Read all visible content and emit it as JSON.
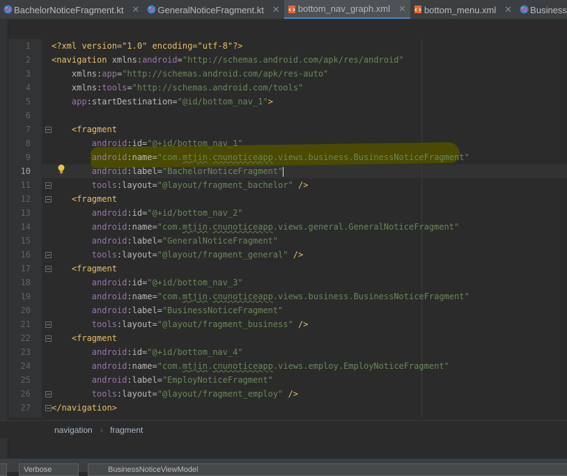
{
  "tabs": [
    {
      "label": "BachelorNoticeFragment.kt",
      "icon": "kotlin-file-icon",
      "active": false
    },
    {
      "label": "GeneralNoticeFragment.kt",
      "icon": "kotlin-file-icon",
      "active": false
    },
    {
      "label": "bottom_nav_graph.xml",
      "icon": "xml-file-icon",
      "active": true
    },
    {
      "label": "bottom_menu.xml",
      "icon": "xml-file-icon",
      "active": false
    },
    {
      "label": "BusinessNoti",
      "icon": "kotlin-file-icon",
      "active": false
    }
  ],
  "close_glyph": "✕",
  "editor": {
    "line_numbers": [
      "1",
      "2",
      "3",
      "4",
      "5",
      "6",
      "7",
      "8",
      "9",
      "10",
      "11",
      "12",
      "13",
      "14",
      "15",
      "16",
      "17",
      "18",
      "19",
      "20",
      "21",
      "22",
      "23",
      "24",
      "25",
      "26",
      "27"
    ],
    "current_line": "10",
    "lines": [
      {
        "indent": "",
        "parts": [
          [
            "pi",
            "<?xml version=\"1.0\" encoding=\"utf-8\"?>"
          ]
        ]
      },
      {
        "indent": "",
        "parts": [
          [
            "t",
            "<navigation "
          ],
          [
            "a",
            "xmlns:"
          ],
          [
            "ns",
            "android"
          ],
          [
            "a",
            "="
          ],
          [
            "v",
            "\"http://schemas.android.com/apk/res/android\""
          ]
        ]
      },
      {
        "indent": "    ",
        "parts": [
          [
            "a",
            "xmlns:"
          ],
          [
            "ns",
            "app"
          ],
          [
            "a",
            "="
          ],
          [
            "v",
            "\"http://schemas.android.com/apk/res-auto\""
          ]
        ]
      },
      {
        "indent": "    ",
        "parts": [
          [
            "a",
            "xmlns:"
          ],
          [
            "ns",
            "tools"
          ],
          [
            "a",
            "="
          ],
          [
            "v",
            "\"http://schemas.android.com/tools\""
          ]
        ]
      },
      {
        "indent": "    ",
        "parts": [
          [
            "ns",
            "app"
          ],
          [
            "a",
            ":startDestination="
          ],
          [
            "v",
            "\"@id/bottom_nav_1\""
          ],
          [
            "t",
            ">"
          ]
        ]
      },
      {
        "indent": "",
        "parts": []
      },
      {
        "indent": "    ",
        "parts": [
          [
            "t",
            "<fragment"
          ]
        ]
      },
      {
        "indent": "        ",
        "parts": [
          [
            "ns",
            "android"
          ],
          [
            "a",
            ":id="
          ],
          [
            "v",
            "\"@+id/bottom_nav_1\""
          ]
        ]
      },
      {
        "indent": "        ",
        "parts": [
          [
            "ns",
            "android"
          ],
          [
            "a",
            ":name="
          ],
          [
            "v",
            "\"com."
          ],
          [
            "vu",
            "mtjin"
          ],
          [
            "v",
            "."
          ],
          [
            "vu",
            "cnunoticeapp"
          ],
          [
            "v",
            ".views.business.BusinessNoticeFragment\""
          ]
        ]
      },
      {
        "indent": "        ",
        "parts": [
          [
            "ns",
            "android"
          ],
          [
            "a",
            ":label="
          ],
          [
            "v",
            "\"BachelorNoticeFragment\""
          ]
        ]
      },
      {
        "indent": "        ",
        "parts": [
          [
            "ns",
            "tools"
          ],
          [
            "a",
            ":layout="
          ],
          [
            "v",
            "\"@layout/fragment_bachelor\""
          ],
          [
            "t",
            " />"
          ]
        ]
      },
      {
        "indent": "    ",
        "parts": [
          [
            "t",
            "<fragment"
          ]
        ]
      },
      {
        "indent": "        ",
        "parts": [
          [
            "ns",
            "android"
          ],
          [
            "a",
            ":id="
          ],
          [
            "v",
            "\"@+id/bottom_nav_2\""
          ]
        ]
      },
      {
        "indent": "        ",
        "parts": [
          [
            "ns",
            "android"
          ],
          [
            "a",
            ":name="
          ],
          [
            "v",
            "\"com."
          ],
          [
            "vu",
            "mtjin"
          ],
          [
            "v",
            "."
          ],
          [
            "vu",
            "cnunoticeapp"
          ],
          [
            "v",
            ".views.general.GeneralNoticeFragment\""
          ]
        ]
      },
      {
        "indent": "        ",
        "parts": [
          [
            "ns",
            "android"
          ],
          [
            "a",
            ":label="
          ],
          [
            "v",
            "\"GeneralNoticeFragment\""
          ]
        ]
      },
      {
        "indent": "        ",
        "parts": [
          [
            "ns",
            "tools"
          ],
          [
            "a",
            ":layout="
          ],
          [
            "v",
            "\"@layout/fragment_general\""
          ],
          [
            "t",
            " />"
          ]
        ]
      },
      {
        "indent": "    ",
        "parts": [
          [
            "t",
            "<fragment"
          ]
        ]
      },
      {
        "indent": "        ",
        "parts": [
          [
            "ns",
            "android"
          ],
          [
            "a",
            ":id="
          ],
          [
            "v",
            "\"@+id/bottom_nav_3\""
          ]
        ]
      },
      {
        "indent": "        ",
        "parts": [
          [
            "ns",
            "android"
          ],
          [
            "a",
            ":name="
          ],
          [
            "v",
            "\"com."
          ],
          [
            "vu",
            "mtjin"
          ],
          [
            "v",
            "."
          ],
          [
            "vu",
            "cnunoticeapp"
          ],
          [
            "v",
            ".views.business.BusinessNoticeFragment\""
          ]
        ]
      },
      {
        "indent": "        ",
        "parts": [
          [
            "ns",
            "android"
          ],
          [
            "a",
            ":label="
          ],
          [
            "v",
            "\"BusinessNoticeFragment\""
          ]
        ]
      },
      {
        "indent": "        ",
        "parts": [
          [
            "ns",
            "tools"
          ],
          [
            "a",
            ":layout="
          ],
          [
            "v",
            "\"@layout/fragment_business\""
          ],
          [
            "t",
            " />"
          ]
        ]
      },
      {
        "indent": "    ",
        "parts": [
          [
            "t",
            "<fragment"
          ]
        ]
      },
      {
        "indent": "        ",
        "parts": [
          [
            "ns",
            "android"
          ],
          [
            "a",
            ":id="
          ],
          [
            "v",
            "\"@+id/bottom_nav_4\""
          ]
        ]
      },
      {
        "indent": "        ",
        "parts": [
          [
            "ns",
            "android"
          ],
          [
            "a",
            ":name="
          ],
          [
            "v",
            "\"com."
          ],
          [
            "vu",
            "mtjin"
          ],
          [
            "v",
            "."
          ],
          [
            "vu",
            "cnunoticeapp"
          ],
          [
            "v",
            ".views.employ.EmployNoticeFragment\""
          ]
        ]
      },
      {
        "indent": "        ",
        "parts": [
          [
            "ns",
            "android"
          ],
          [
            "a",
            ":label="
          ],
          [
            "v",
            "\"EmployNoticeFragment\""
          ]
        ]
      },
      {
        "indent": "        ",
        "parts": [
          [
            "ns",
            "tools"
          ],
          [
            "a",
            ":layout="
          ],
          [
            "v",
            "\"@layout/fragment_employ\""
          ],
          [
            "t",
            " />"
          ]
        ]
      },
      {
        "indent": "",
        "parts": [
          [
            "t",
            "</navigation>"
          ]
        ]
      }
    ]
  },
  "breadcrumb": {
    "items": [
      "navigation",
      "fragment"
    ],
    "separator": "›"
  },
  "bottom_bar": {
    "log_level": "Verbose",
    "filter": "BusinessNoticeViewModel"
  },
  "colors": {
    "accent": "#4a88c7",
    "tag": "#e8bf6a",
    "value": "#6a8759",
    "namespace": "#9876aa",
    "highlighter": "#4c4c00"
  }
}
